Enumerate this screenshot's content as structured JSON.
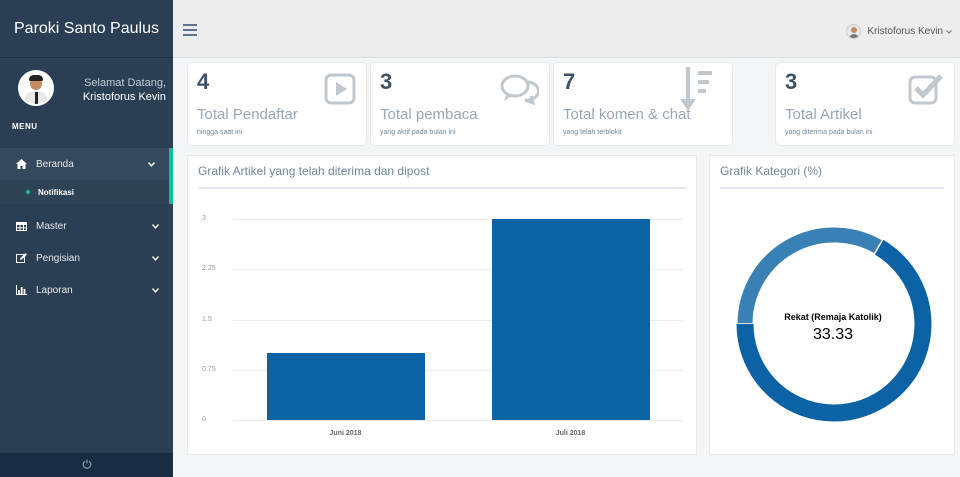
{
  "sidebar": {
    "brand": "Paroki Santo Paulus",
    "welcome": "Selamat Datang,",
    "user_name": "Kristoforus Kevin",
    "menu_label": "MENU",
    "items": [
      {
        "label": "Beranda",
        "icon": "home-icon"
      },
      {
        "label": "Notifikasi"
      },
      {
        "label": "Master",
        "icon": "table-icon"
      },
      {
        "label": "Pengisian",
        "icon": "edit-icon"
      },
      {
        "label": "Laporan",
        "icon": "bar-chart-icon"
      }
    ],
    "footer_icon": "power-icon"
  },
  "topbar": {
    "user_name": "Kristoforus Kevin"
  },
  "tiles": [
    {
      "count": "4",
      "label": "Total Pendaftar",
      "sub": "hingga saat ini",
      "icon": "play-icon"
    },
    {
      "count": "3",
      "label": "Total pembaca",
      "sub": "yang aktif pada bulan ini",
      "icon": "comments-icon"
    },
    {
      "count": "7",
      "label": "Total komen & chat",
      "sub": "yang telah terblokir",
      "icon": "sort-amount-icon"
    },
    {
      "count": "3",
      "label": "Total Artikel",
      "sub": "yang diterima pada bulan ini",
      "icon": "check-square-icon"
    }
  ],
  "colors": {
    "sidebar": "#2a3f54",
    "accent": "#1abb9c",
    "bar": "#0b62a4",
    "donut_light": "#3980b5"
  },
  "chart_data": [
    {
      "type": "bar",
      "title": "Grafik Artikel yang telah diterima dan dipost",
      "categories": [
        "Juni 2018",
        "Juli 2018"
      ],
      "values": [
        1,
        3
      ],
      "y_ticks": [
        "0",
        "0.75",
        "1.5",
        "2.25",
        "3"
      ],
      "ylim": [
        0,
        3
      ]
    },
    {
      "type": "pie",
      "title": "Grafik Kategori (%)",
      "slices": [
        {
          "label": "Rekat (Remaja Katolik)",
          "value": 33.33,
          "color": "#3980b5"
        },
        {
          "label": "",
          "value": 66.67,
          "color": "#0b62a4"
        }
      ],
      "center_label": "Rekat (Remaja Katolik)",
      "center_value": "33.33"
    }
  ]
}
